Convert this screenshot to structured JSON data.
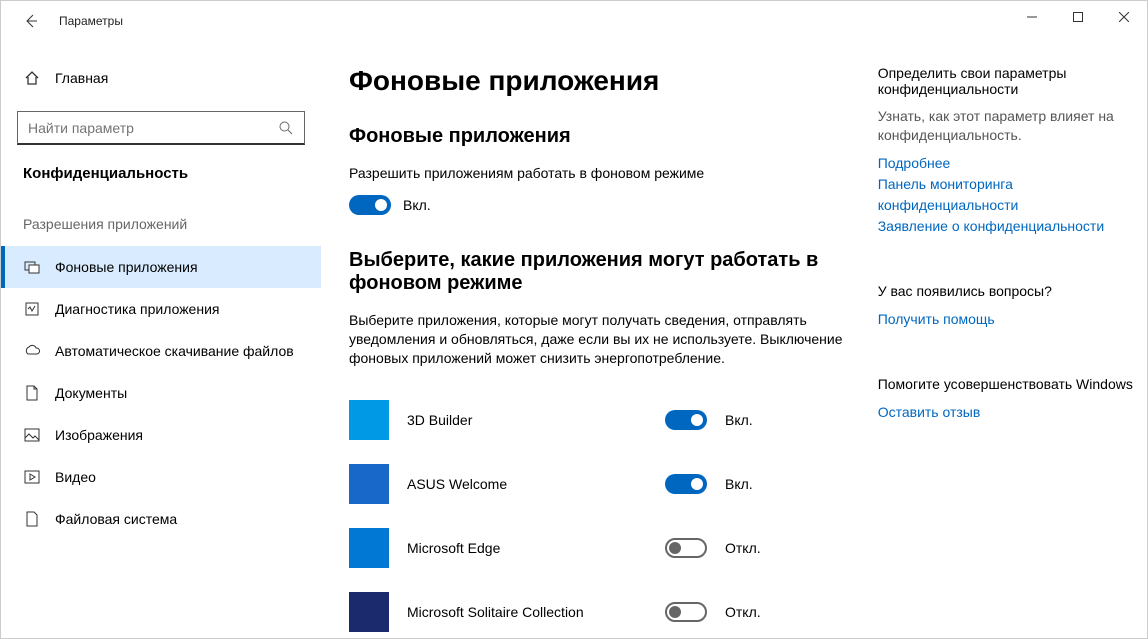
{
  "window": {
    "title": "Параметры"
  },
  "sidebar": {
    "home": "Главная",
    "search_placeholder": "Найти параметр",
    "category": "Конфиденциальность",
    "group": "Разрешения приложений",
    "items": [
      {
        "label": "Фоновые приложения"
      },
      {
        "label": "Диагностика приложения"
      },
      {
        "label": "Автоматическое скачивание файлов"
      },
      {
        "label": "Документы"
      },
      {
        "label": "Изображения"
      },
      {
        "label": "Видео"
      },
      {
        "label": "Файловая система"
      }
    ]
  },
  "main": {
    "title": "Фоновые приложения",
    "section1_h": "Фоновые приложения",
    "section1_text": "Разрешить приложениям работать в фоновом режиме",
    "master_toggle": {
      "label": "Вкл.",
      "on": true
    },
    "section2_h": "Выберите, какие приложения могут работать в фоновом режиме",
    "section2_text": "Выберите приложения, которые могут получать сведения, отправлять уведомления и обновляться, даже если вы их не используете. Выключение фоновых приложений может снизить энергопотребление.",
    "apps": [
      {
        "name": "3D Builder",
        "on": true,
        "label": "Вкл.",
        "color": "#0099e5"
      },
      {
        "name": "ASUS Welcome",
        "on": true,
        "label": "Вкл.",
        "color": "#1868c9"
      },
      {
        "name": "Microsoft Edge",
        "on": false,
        "label": "Откл.",
        "color": "#0078d4"
      },
      {
        "name": "Microsoft Solitaire Collection",
        "on": false,
        "label": "Откл.",
        "color": "#1a2a6c"
      }
    ]
  },
  "side": {
    "g1_h": "Определить свои параметры конфиденциальности",
    "g1_text": "Узнать, как этот параметр влияет на конфиденциальность.",
    "g1_links": [
      "Подробнее",
      "Панель мониторинга конфиденциальности",
      "Заявление о конфиденциальности"
    ],
    "g2_h": "У вас появились вопросы?",
    "g2_link": "Получить помощь",
    "g3_h": "Помогите усовершенствовать Windows",
    "g3_link": "Оставить отзыв"
  }
}
